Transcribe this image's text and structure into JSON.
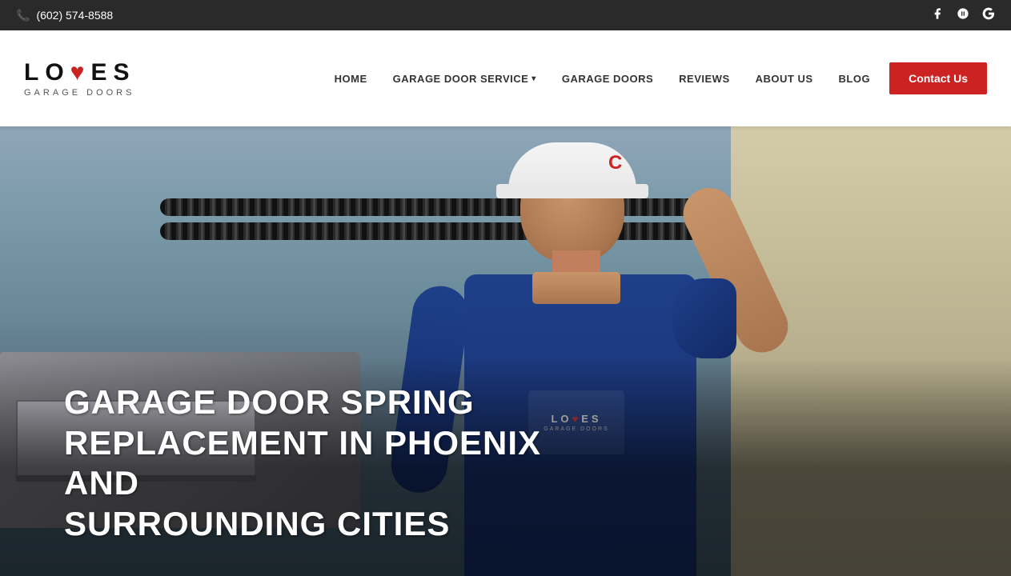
{
  "topbar": {
    "phone": "(602) 574-8588",
    "social_icons": [
      "facebook",
      "yelp",
      "google"
    ]
  },
  "header": {
    "logo": {
      "line1_pre": "LO",
      "line1_heart": "♥",
      "line1_post": "ES",
      "line2": "GARAGE DOORS"
    },
    "nav": {
      "items": [
        {
          "label": "HOME",
          "has_dropdown": false
        },
        {
          "label": "GARAGE DOOR SERVICE",
          "has_dropdown": true
        },
        {
          "label": "GARAGE DOORS",
          "has_dropdown": false
        },
        {
          "label": "REVIEWS",
          "has_dropdown": false
        },
        {
          "label": "ABOUT US",
          "has_dropdown": false
        },
        {
          "label": "BLOG",
          "has_dropdown": false
        }
      ],
      "contact_button": "Contact Us"
    }
  },
  "hero": {
    "heading_line1": "GARAGE DOOR SPRING REPLACEMENT IN PHOENIX AND",
    "heading_line2": "SURROUNDING CITIES",
    "heading_combined": "GARAGE DOOR SPRING REPLACEMENT IN PHOENIX AND SURROUNDING CITIES"
  },
  "colors": {
    "accent_red": "#cc2222",
    "top_bar_bg": "#2a2a2a",
    "nav_text": "#333333",
    "hero_text": "#ffffff"
  }
}
